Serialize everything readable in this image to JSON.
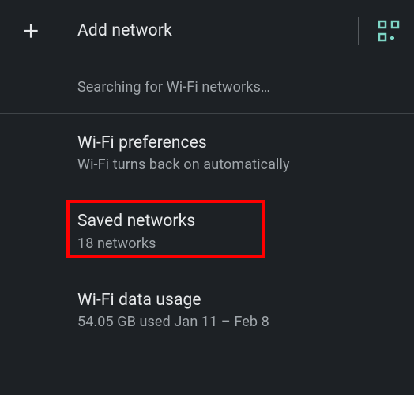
{
  "header": {
    "title": "Add network"
  },
  "status": {
    "text": "Searching for Wi-Fi networks…"
  },
  "items": [
    {
      "title": "Wi-Fi preferences",
      "subtitle": "Wi-Fi turns back on automatically"
    },
    {
      "title": "Saved networks",
      "subtitle": "18 networks"
    },
    {
      "title": "Wi-Fi data usage",
      "subtitle": "54.05 GB used Jan 11 – Feb 8"
    }
  ],
  "colors": {
    "accent": "#7ed6c6",
    "highlight": "#ff0000"
  }
}
